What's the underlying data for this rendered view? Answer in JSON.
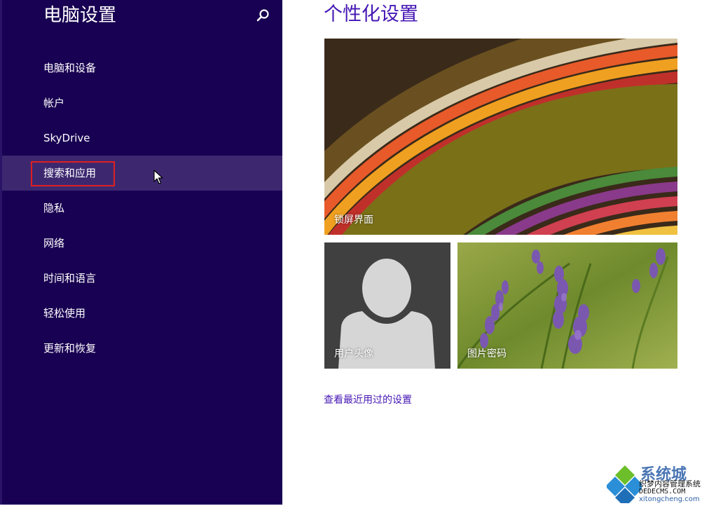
{
  "sidebar": {
    "title": "电脑设置",
    "items": [
      {
        "label": "电脑和设备"
      },
      {
        "label": "帐户"
      },
      {
        "label": "SkyDrive"
      },
      {
        "label": "搜索和应用",
        "selected": true
      },
      {
        "label": "隐私"
      },
      {
        "label": "网络"
      },
      {
        "label": "时间和语言"
      },
      {
        "label": "轻松使用"
      },
      {
        "label": "更新和恢复"
      }
    ]
  },
  "main": {
    "title": "个性化设置",
    "tiles": {
      "lock_screen": "锁屏界面",
      "account_picture": "用户头像",
      "picture_password": "图片密码"
    },
    "recent_link": "查看最近用过的设置"
  },
  "watermark": {
    "title": "系统城",
    "subtitle": "织梦内容管理系统",
    "site": "DEDECMS.COM",
    "domain": "xitongcheng.com"
  },
  "colors": {
    "sidebar_bg": "#180052",
    "selected_bg": "#3d2870",
    "accent": "#4617b4",
    "highlight_border": "#e02020"
  },
  "icons": {
    "search": "search-icon",
    "cursor": "mouse-cursor-icon",
    "avatar": "person-silhouette-icon"
  }
}
